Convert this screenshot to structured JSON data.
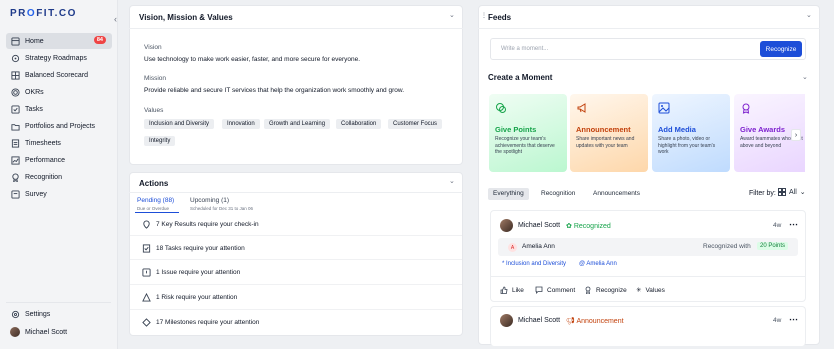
{
  "logo": {
    "part1": "PR",
    "part2": "O",
    "part3": "FIT.CO"
  },
  "sidebar": {
    "items": [
      {
        "label": "Home",
        "badge": "84"
      },
      {
        "label": "Strategy Roadmaps"
      },
      {
        "label": "Balanced Scorecard"
      },
      {
        "label": "OKRs"
      },
      {
        "label": "Tasks"
      },
      {
        "label": "Portfolios and Projects"
      },
      {
        "label": "Timesheets"
      },
      {
        "label": "Performance"
      },
      {
        "label": "Recognition"
      },
      {
        "label": "Survey"
      }
    ],
    "settings": "Settings",
    "user": "Michael Scott"
  },
  "vision": {
    "title": "Vision, Mission & Values",
    "vision_label": "Vision",
    "vision_text": "Use technology to make work easier, faster, and more secure for everyone.",
    "mission_label": "Mission",
    "mission_text": "Provide reliable and secure IT services that help the organization work smoothly and grow.",
    "values_label": "Values",
    "values": [
      "Inclusion and Diversity",
      "Innovation",
      "Growth and Learning",
      "Collaboration",
      "Customer Focus",
      "Integrity"
    ]
  },
  "actions": {
    "title": "Actions",
    "tab_pending": "Pending (88)",
    "tab_pending_sub": "Due or Overdue",
    "tab_upcoming": "Upcoming (1)",
    "tab_upcoming_sub": "Scheduled for Dec 31 to Jan 06",
    "rows": [
      "7 Key Results require your check-in",
      "18 Tasks require your attention",
      "1 Issue require your attention",
      "1 Risk require your attention",
      "17 Milestones require your attention"
    ]
  },
  "feeds": {
    "title": "Feeds",
    "input_placeholder": "Write a moment...",
    "recognize_button": "Recognize",
    "create_title": "Create a Moment",
    "cards": [
      {
        "title": "Give Points",
        "desc": "Recognize your team's achievements that deserve the spotlight",
        "color": "#16a34a"
      },
      {
        "title": "Announcement",
        "desc": "Share important news and updates with your team",
        "color": "#c2410c"
      },
      {
        "title": "Add Media",
        "desc": "Share a photo, video or highlight from your team's work",
        "color": "#1d4ed8"
      },
      {
        "title": "Give Awards",
        "desc": "Award teammates who went above and beyond",
        "color": "#7e22ce"
      }
    ],
    "filters": [
      "Everything",
      "Recognition",
      "Announcements"
    ],
    "filter_by_label": "Filter by:",
    "filter_value": "All",
    "post1": {
      "author": "Michael Scott",
      "type": "Recognized",
      "time": "4w",
      "recipient_initial": "A",
      "recipient": "Amelia Ann",
      "recognized_with": "Recognized with",
      "points": "20 Points",
      "value_tag": "* Inclusion and Diversity",
      "mention": "@ Amelia Ann",
      "actions": [
        "Like",
        "Comment",
        "Recognize",
        "Values"
      ]
    },
    "post2": {
      "author": "Michael Scott",
      "type": "Announcement",
      "time": "4w"
    }
  }
}
